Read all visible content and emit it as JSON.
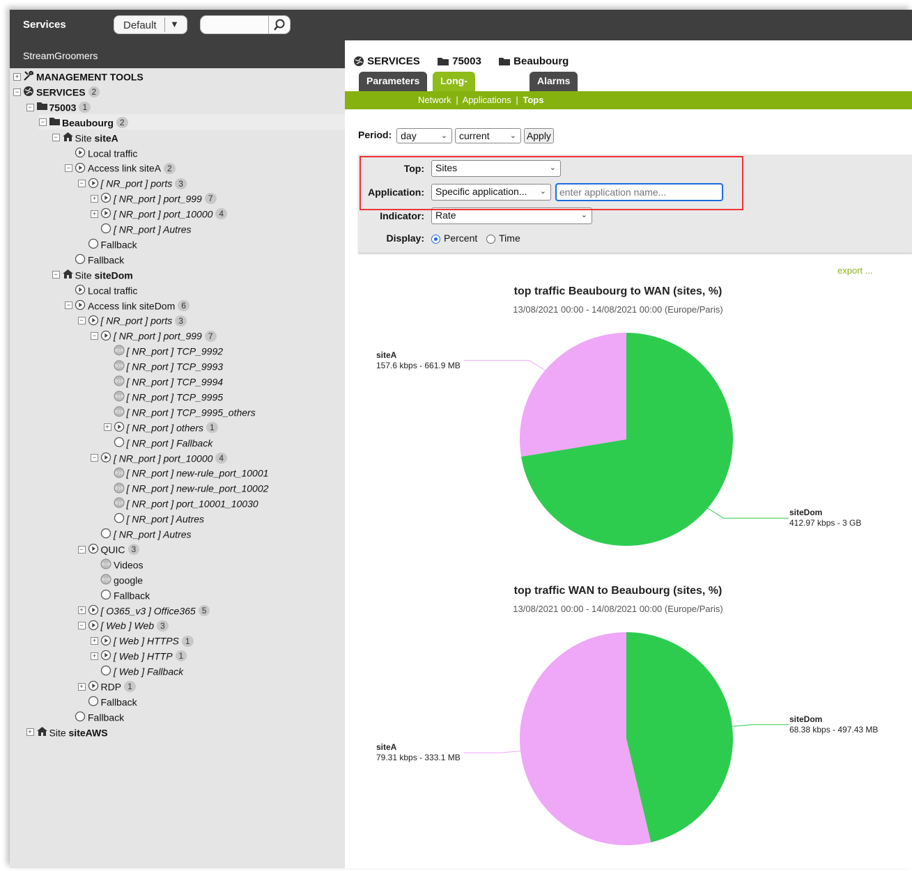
{
  "topbar": {
    "title": "Services",
    "preset": "Default",
    "search_placeholder": ""
  },
  "sidebar": {
    "subtitle": "StreamGroomers"
  },
  "tree": [
    {
      "depth": 0,
      "toggle": "+",
      "icon": "tools-icon",
      "label": "MANAGEMENT TOOLS",
      "style": "b",
      "count": null
    },
    {
      "depth": 0,
      "toggle": "-",
      "icon": "globe-icon",
      "label": "SERVICES",
      "style": "b",
      "count": "2"
    },
    {
      "depth": 1,
      "toggle": "-",
      "icon": "folder-icon",
      "label": "75003",
      "style": "b",
      "count": "1"
    },
    {
      "depth": 2,
      "toggle": "-",
      "icon": "folder-icon",
      "label": "Beaubourg",
      "style": "b",
      "count": "2",
      "selected": true
    },
    {
      "depth": 3,
      "toggle": "-",
      "icon": "house-icon",
      "label": "Site ",
      "label_b": "siteA",
      "style": "",
      "count": null
    },
    {
      "depth": 4,
      "toggle": "",
      "icon": "play-icon",
      "label": "Local traffic",
      "style": "",
      "count": null
    },
    {
      "depth": 4,
      "toggle": "-",
      "icon": "play-icon",
      "label": "Access link siteA",
      "style": "",
      "count": "2"
    },
    {
      "depth": 5,
      "toggle": "-",
      "icon": "play-icon",
      "label": "[ NR_port ] ports",
      "style": "i",
      "count": "3"
    },
    {
      "depth": 6,
      "toggle": "+",
      "icon": "play-icon",
      "label": "[ NR_port ] port_999",
      "style": "i",
      "count": "7"
    },
    {
      "depth": 6,
      "toggle": "+",
      "icon": "play-icon",
      "label": "[ NR_port ] port_10000",
      "style": "i",
      "count": "4"
    },
    {
      "depth": 6,
      "toggle": "",
      "icon": "circle-icon",
      "label": "[ NR_port ] Autres",
      "style": "i",
      "count": null
    },
    {
      "depth": 5,
      "toggle": "",
      "icon": "circle-icon",
      "label": "Fallback",
      "style": "",
      "count": null
    },
    {
      "depth": 4,
      "toggle": "",
      "icon": "circle-icon",
      "label": "Fallback",
      "style": "",
      "count": null
    },
    {
      "depth": 3,
      "toggle": "-",
      "icon": "house-icon",
      "label": "Site ",
      "label_b": "siteDom",
      "style": "",
      "count": null
    },
    {
      "depth": 4,
      "toggle": "",
      "icon": "play-icon",
      "label": "Local traffic",
      "style": "",
      "count": null
    },
    {
      "depth": 4,
      "toggle": "-",
      "icon": "play-icon",
      "label": "Access link siteDom",
      "style": "",
      "count": "6"
    },
    {
      "depth": 5,
      "toggle": "-",
      "icon": "play-icon",
      "label": "[ NR_port ] ports",
      "style": "i",
      "count": "3"
    },
    {
      "depth": 6,
      "toggle": "-",
      "icon": "play-icon",
      "label": "[ NR_port ] port_999",
      "style": "i",
      "count": "7"
    },
    {
      "depth": 7,
      "toggle": "",
      "icon": "binary-icon",
      "label": "[ NR_port ] TCP_9992",
      "style": "i",
      "count": null
    },
    {
      "depth": 7,
      "toggle": "",
      "icon": "binary-icon",
      "label": "[ NR_port ] TCP_9993",
      "style": "i",
      "count": null
    },
    {
      "depth": 7,
      "toggle": "",
      "icon": "binary-icon",
      "label": "[ NR_port ] TCP_9994",
      "style": "i",
      "count": null
    },
    {
      "depth": 7,
      "toggle": "",
      "icon": "binary-icon",
      "label": "[ NR_port ] TCP_9995",
      "style": "i",
      "count": null
    },
    {
      "depth": 7,
      "toggle": "",
      "icon": "binary-icon",
      "label": "[ NR_port ] TCP_9995_others",
      "style": "i",
      "count": null
    },
    {
      "depth": 7,
      "toggle": "+",
      "icon": "play-icon",
      "label": "[ NR_port ] others",
      "style": "i",
      "count": "1"
    },
    {
      "depth": 7,
      "toggle": "",
      "icon": "circle-icon",
      "label": "[ NR_port ] Fallback",
      "style": "i",
      "count": null
    },
    {
      "depth": 6,
      "toggle": "-",
      "icon": "play-icon",
      "label": "[ NR_port ] port_10000",
      "style": "i",
      "count": "4"
    },
    {
      "depth": 7,
      "toggle": "",
      "icon": "binary-icon",
      "label": "[ NR_port ] new-rule_port_10001",
      "style": "i",
      "count": null
    },
    {
      "depth": 7,
      "toggle": "",
      "icon": "binary-icon",
      "label": "[ NR_port ] new-rule_port_10002",
      "style": "i",
      "count": null
    },
    {
      "depth": 7,
      "toggle": "",
      "icon": "binary-icon",
      "label": "[ NR_port ] port_10001_10030",
      "style": "i",
      "count": null
    },
    {
      "depth": 7,
      "toggle": "",
      "icon": "circle-icon",
      "label": "[ NR_port ] Autres",
      "style": "i",
      "count": null
    },
    {
      "depth": 6,
      "toggle": "",
      "icon": "circle-icon",
      "label": "[ NR_port ] Autres",
      "style": "i",
      "count": null
    },
    {
      "depth": 5,
      "toggle": "-",
      "icon": "play-icon",
      "label": "QUIC",
      "style": "",
      "count": "3"
    },
    {
      "depth": 6,
      "toggle": "",
      "icon": "binary-icon",
      "label": "Videos",
      "style": "",
      "count": null
    },
    {
      "depth": 6,
      "toggle": "",
      "icon": "binary-icon",
      "label": "google",
      "style": "",
      "count": null
    },
    {
      "depth": 6,
      "toggle": "",
      "icon": "circle-icon",
      "label": "Fallback",
      "style": "",
      "count": null
    },
    {
      "depth": 5,
      "toggle": "+",
      "icon": "play-icon",
      "label": "[ O365_v3 ] Office365",
      "style": "i",
      "count": "5"
    },
    {
      "depth": 5,
      "toggle": "-",
      "icon": "play-icon",
      "label": "[ Web ] Web",
      "style": "i",
      "count": "3"
    },
    {
      "depth": 6,
      "toggle": "+",
      "icon": "play-icon",
      "label": "[ Web ] HTTPS",
      "style": "i",
      "count": "1"
    },
    {
      "depth": 6,
      "toggle": "+",
      "icon": "play-icon",
      "label": "[ Web ] HTTP",
      "style": "i",
      "count": "1"
    },
    {
      "depth": 6,
      "toggle": "",
      "icon": "circle-icon",
      "label": "[ Web ] Fallback",
      "style": "i",
      "count": null
    },
    {
      "depth": 5,
      "toggle": "+",
      "icon": "play-icon",
      "label": "RDP",
      "style": "",
      "count": "1"
    },
    {
      "depth": 5,
      "toggle": "",
      "icon": "circle-icon",
      "label": "Fallback",
      "style": "",
      "count": null
    },
    {
      "depth": 4,
      "toggle": "",
      "icon": "circle-icon",
      "label": "Fallback",
      "style": "",
      "count": null
    },
    {
      "depth": 1,
      "toggle": "+",
      "icon": "house-icon",
      "label": "Site ",
      "label_b": "siteAWS",
      "style": "",
      "count": null
    }
  ],
  "main": {
    "breadcrumb": [
      "SERVICES",
      "75003",
      "Beaubourg"
    ],
    "tabs": [
      {
        "label": "Parameters",
        "active": false
      },
      {
        "label": "Long-term stats",
        "active": true
      },
      {
        "label": "Alarms",
        "active": false
      }
    ],
    "subnav": {
      "network": "Network",
      "applications": "Applications",
      "tops": "Tops",
      "separator": "|"
    },
    "period": {
      "label": "Period:",
      "range": "day",
      "when": "current",
      "apply": "Apply"
    },
    "form": {
      "top_label": "Top:",
      "top_value": "Sites",
      "application_label": "Application:",
      "application_value": "Specific application...",
      "application_placeholder": "enter application name...",
      "indicator_label": "Indicator:",
      "indicator_value": "Rate",
      "display_label": "Display:",
      "display_opt1": "Percent",
      "display_opt2": "Time",
      "display_selected": "Percent"
    },
    "export": "export ..."
  },
  "colors": {
    "siteA": "#efa7f7",
    "siteDom": "#2dcc4f",
    "accent": "#86b20f"
  },
  "chart_data": [
    {
      "type": "pie",
      "title": "top traffic Beaubourg to WAN (sites, %)",
      "subtitle": "13/08/2021 00:00 - 14/08/2021 00:00 (Europe/Paris)",
      "slices": [
        {
          "name": "siteDom",
          "value": 72.4,
          "detail": "412.97 kbps - 3 GB"
        },
        {
          "name": "siteA",
          "value": 27.6,
          "detail": "157.6 kbps - 661.9 MB"
        }
      ]
    },
    {
      "type": "pie",
      "title": "top traffic WAN to Beaubourg (sites, %)",
      "subtitle": "13/08/2021 00:00 - 14/08/2021 00:00 (Europe/Paris)",
      "slices": [
        {
          "name": "siteDom",
          "value": 46.3,
          "detail": "68.38 kbps - 497.43 MB"
        },
        {
          "name": "siteA",
          "value": 53.7,
          "detail": "79.31 kbps - 333.1 MB"
        }
      ]
    }
  ]
}
